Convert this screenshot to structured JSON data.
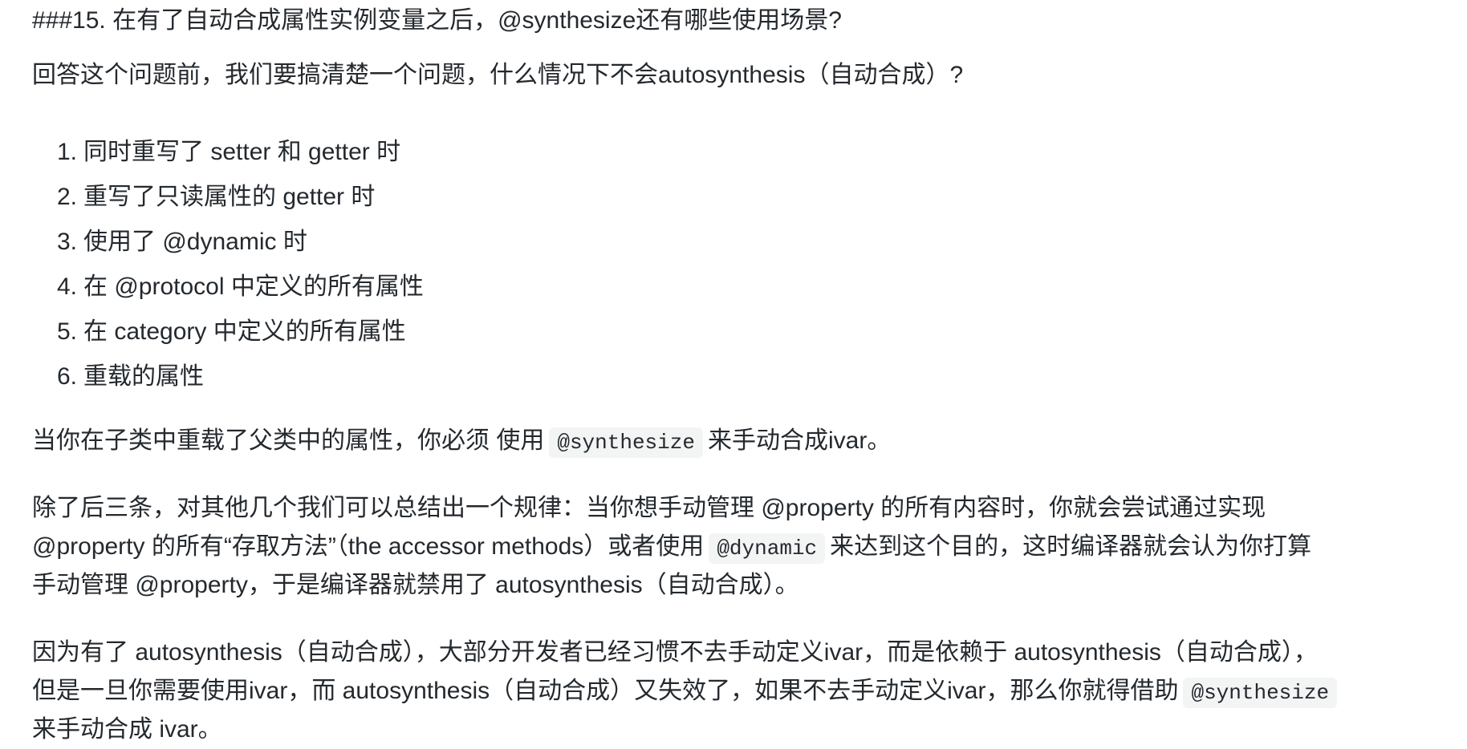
{
  "heading": "###15. 在有了自动合成属性实例变量之后，@synthesize还有哪些使用场景?",
  "intro": "回答这个问题前，我们要搞清楚一个问题，什么情况下不会autosynthesis（自动合成）?",
  "list": [
    {
      "num": "1.",
      "text": "同时重写了 setter 和 getter 时"
    },
    {
      "num": "2.",
      "text": "重写了只读属性的 getter 时"
    },
    {
      "num": "3.",
      "text": "使用了 @dynamic 时"
    },
    {
      "num": "4.",
      "text": "在 @protocol 中定义的所有属性"
    },
    {
      "num": "5.",
      "text": "在 category 中定义的所有属性"
    },
    {
      "num": "6.",
      "text": "重载的属性"
    }
  ],
  "para1": {
    "before": "当你在子类中重载了父类中的属性，你必须 使用",
    "code": "@synthesize",
    "after": "来手动合成ivar。"
  },
  "para2": {
    "line1": "除了后三条，对其他几个我们可以总结出一个规律：当你想手动管理 @property 的所有内容时，你就会尝试通过实现",
    "line2_before": "@property 的所有“存取方法”（the accessor methods）或者使用",
    "line2_code": "@dynamic",
    "line2_after": "来达到这个目的，这时编译器就会认为你打算",
    "line3": "手动管理 @property，于是编译器就禁用了 autosynthesis（自动合成）。"
  },
  "para3": {
    "line1": "因为有了 autosynthesis（自动合成），大部分开发者已经习惯不去手动定义ivar，而是依赖于 autosynthesis（自动合成），",
    "line2_before": "但是一旦你需要使用ivar，而 autosynthesis（自动合成）又失效了，如果不去手动定义ivar，那么你就得借助",
    "line2_code": "@synthesize",
    "line3": "来手动合成 ivar。"
  }
}
